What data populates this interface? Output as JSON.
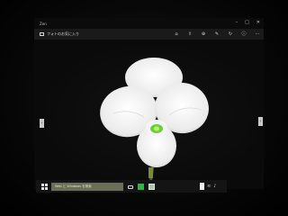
{
  "window": {
    "app_name": "Zen",
    "title": "フォトのお気に入り",
    "controls": [
      "–",
      "□",
      "✕"
    ]
  },
  "command_bar": {
    "actions": [
      {
        "icon": "home-icon",
        "glyph": "⌂"
      },
      {
        "icon": "share-icon",
        "glyph": "⇪"
      },
      {
        "icon": "zoom-icon",
        "glyph": "⊕"
      },
      {
        "icon": "edit-icon",
        "glyph": "✎"
      },
      {
        "icon": "rotate-icon",
        "glyph": "↻"
      },
      {
        "icon": "info-icon",
        "glyph": "ⓘ"
      },
      {
        "icon": "more-icon",
        "glyph": "⋯"
      }
    ]
  },
  "photo": {
    "subject": "white orchid flower"
  },
  "navigation": {
    "prev_glyph": "‹",
    "next_glyph": "›"
  },
  "taskbar": {
    "search_placeholder": "Web と Windows を検索",
    "colors": {
      "store": "#38b04a",
      "search_bg": "#6c6e58"
    }
  },
  "tray": {
    "wifi_glyph": "≋",
    "volume_glyph": "♪"
  }
}
